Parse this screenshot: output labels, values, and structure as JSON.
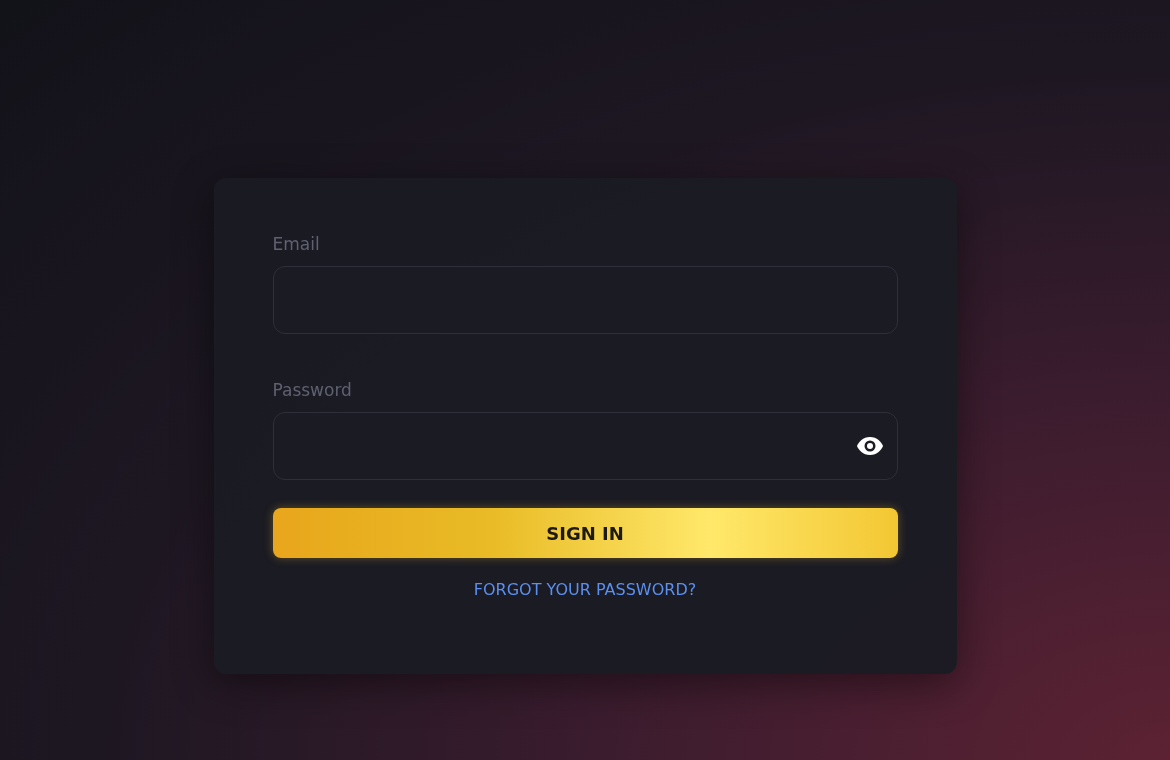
{
  "form": {
    "fields": [
      {
        "label": "Email",
        "kind": "text"
      },
      {
        "label": "Password",
        "kind": "password"
      }
    ],
    "submit": "SIGN IN",
    "forgot_link": "FORGOT YOUR PASSWORD?"
  }
}
